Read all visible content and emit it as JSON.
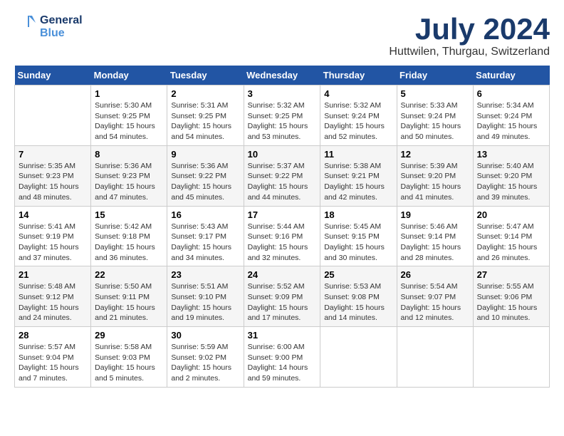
{
  "header": {
    "logo_line1": "General",
    "logo_line2": "Blue",
    "month_title": "July 2024",
    "location": "Huttwilen, Thurgau, Switzerland"
  },
  "days_of_week": [
    "Sunday",
    "Monday",
    "Tuesday",
    "Wednesday",
    "Thursday",
    "Friday",
    "Saturday"
  ],
  "weeks": [
    [
      {
        "day": "",
        "info": ""
      },
      {
        "day": "1",
        "info": "Sunrise: 5:30 AM\nSunset: 9:25 PM\nDaylight: 15 hours\nand 54 minutes."
      },
      {
        "day": "2",
        "info": "Sunrise: 5:31 AM\nSunset: 9:25 PM\nDaylight: 15 hours\nand 54 minutes."
      },
      {
        "day": "3",
        "info": "Sunrise: 5:32 AM\nSunset: 9:25 PM\nDaylight: 15 hours\nand 53 minutes."
      },
      {
        "day": "4",
        "info": "Sunrise: 5:32 AM\nSunset: 9:24 PM\nDaylight: 15 hours\nand 52 minutes."
      },
      {
        "day": "5",
        "info": "Sunrise: 5:33 AM\nSunset: 9:24 PM\nDaylight: 15 hours\nand 50 minutes."
      },
      {
        "day": "6",
        "info": "Sunrise: 5:34 AM\nSunset: 9:24 PM\nDaylight: 15 hours\nand 49 minutes."
      }
    ],
    [
      {
        "day": "7",
        "info": "Sunrise: 5:35 AM\nSunset: 9:23 PM\nDaylight: 15 hours\nand 48 minutes."
      },
      {
        "day": "8",
        "info": "Sunrise: 5:36 AM\nSunset: 9:23 PM\nDaylight: 15 hours\nand 47 minutes."
      },
      {
        "day": "9",
        "info": "Sunrise: 5:36 AM\nSunset: 9:22 PM\nDaylight: 15 hours\nand 45 minutes."
      },
      {
        "day": "10",
        "info": "Sunrise: 5:37 AM\nSunset: 9:22 PM\nDaylight: 15 hours\nand 44 minutes."
      },
      {
        "day": "11",
        "info": "Sunrise: 5:38 AM\nSunset: 9:21 PM\nDaylight: 15 hours\nand 42 minutes."
      },
      {
        "day": "12",
        "info": "Sunrise: 5:39 AM\nSunset: 9:20 PM\nDaylight: 15 hours\nand 41 minutes."
      },
      {
        "day": "13",
        "info": "Sunrise: 5:40 AM\nSunset: 9:20 PM\nDaylight: 15 hours\nand 39 minutes."
      }
    ],
    [
      {
        "day": "14",
        "info": "Sunrise: 5:41 AM\nSunset: 9:19 PM\nDaylight: 15 hours\nand 37 minutes."
      },
      {
        "day": "15",
        "info": "Sunrise: 5:42 AM\nSunset: 9:18 PM\nDaylight: 15 hours\nand 36 minutes."
      },
      {
        "day": "16",
        "info": "Sunrise: 5:43 AM\nSunset: 9:17 PM\nDaylight: 15 hours\nand 34 minutes."
      },
      {
        "day": "17",
        "info": "Sunrise: 5:44 AM\nSunset: 9:16 PM\nDaylight: 15 hours\nand 32 minutes."
      },
      {
        "day": "18",
        "info": "Sunrise: 5:45 AM\nSunset: 9:15 PM\nDaylight: 15 hours\nand 30 minutes."
      },
      {
        "day": "19",
        "info": "Sunrise: 5:46 AM\nSunset: 9:14 PM\nDaylight: 15 hours\nand 28 minutes."
      },
      {
        "day": "20",
        "info": "Sunrise: 5:47 AM\nSunset: 9:14 PM\nDaylight: 15 hours\nand 26 minutes."
      }
    ],
    [
      {
        "day": "21",
        "info": "Sunrise: 5:48 AM\nSunset: 9:12 PM\nDaylight: 15 hours\nand 24 minutes."
      },
      {
        "day": "22",
        "info": "Sunrise: 5:50 AM\nSunset: 9:11 PM\nDaylight: 15 hours\nand 21 minutes."
      },
      {
        "day": "23",
        "info": "Sunrise: 5:51 AM\nSunset: 9:10 PM\nDaylight: 15 hours\nand 19 minutes."
      },
      {
        "day": "24",
        "info": "Sunrise: 5:52 AM\nSunset: 9:09 PM\nDaylight: 15 hours\nand 17 minutes."
      },
      {
        "day": "25",
        "info": "Sunrise: 5:53 AM\nSunset: 9:08 PM\nDaylight: 15 hours\nand 14 minutes."
      },
      {
        "day": "26",
        "info": "Sunrise: 5:54 AM\nSunset: 9:07 PM\nDaylight: 15 hours\nand 12 minutes."
      },
      {
        "day": "27",
        "info": "Sunrise: 5:55 AM\nSunset: 9:06 PM\nDaylight: 15 hours\nand 10 minutes."
      }
    ],
    [
      {
        "day": "28",
        "info": "Sunrise: 5:57 AM\nSunset: 9:04 PM\nDaylight: 15 hours\nand 7 minutes."
      },
      {
        "day": "29",
        "info": "Sunrise: 5:58 AM\nSunset: 9:03 PM\nDaylight: 15 hours\nand 5 minutes."
      },
      {
        "day": "30",
        "info": "Sunrise: 5:59 AM\nSunset: 9:02 PM\nDaylight: 15 hours\nand 2 minutes."
      },
      {
        "day": "31",
        "info": "Sunrise: 6:00 AM\nSunset: 9:00 PM\nDaylight: 14 hours\nand 59 minutes."
      },
      {
        "day": "",
        "info": ""
      },
      {
        "day": "",
        "info": ""
      },
      {
        "day": "",
        "info": ""
      }
    ]
  ]
}
